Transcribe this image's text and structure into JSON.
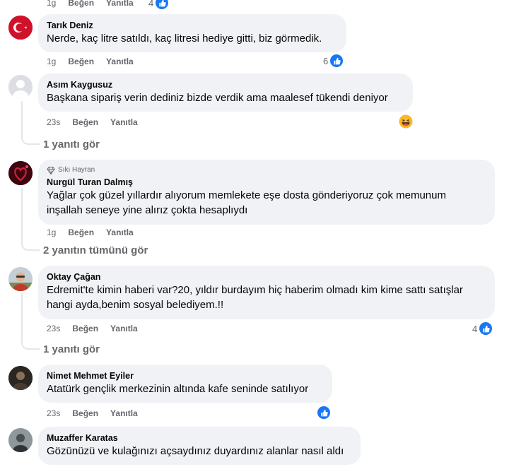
{
  "top": {
    "time": "1g",
    "like": "Beğen",
    "reply": "Yanıtla",
    "count": "4"
  },
  "comments": [
    {
      "name": "Tarık Deniz",
      "text": "Nerde, kaç litre satıldı, kaç litresi hediye gitti, biz görmedik.",
      "time": "1g",
      "like": "Beğen",
      "reply": "Yanıtla",
      "count": "6"
    },
    {
      "name": "Asım Kaygusuz",
      "text": "Başkana sipariş verin dediniz bizde verdik ama maalesef tükendi deniyor",
      "time": "23s",
      "like": "Beğen",
      "reply": "Yanıtla",
      "reaction": "haha-emoji",
      "replies": "1 yanıtı gör"
    },
    {
      "badge": "Sıkı Hayran",
      "name": "Nurgül Turan Dalmış",
      "text1": "Yağlar çok güzel yıllardır alıyorum memlekete eşe dosta gönderiyoruz çok memunum",
      "text2": "inşallah seneye yine alırız çokta hesaplıydı",
      "time": "1g",
      "like": "Beğen",
      "reply": "Yanıtla",
      "replies": "2 yanıtın tümünü gör"
    },
    {
      "name": "Oktay Çağan",
      "text1": "Edremit'te kimin haberi var?20, yıldır burdayım hiç haberim olmadı kim kime sattı satışlar",
      "text2": "hangi ayda,benim sosyal belediyem.!!",
      "time": "23s",
      "like": "Beğen",
      "reply": "Yanıtla",
      "count": "4",
      "replies": "1 yanıtı gör"
    },
    {
      "name": "Nimet Mehmet Eyiler",
      "text": "Atatürk gençlik merkezinin altında kafe seninde satılıyor",
      "time": "23s",
      "like": "Beğen",
      "reply": "Yanıtla"
    },
    {
      "name": "Muzaffer Karatas",
      "text": "Gözünüzü ve kulağınızı açsaydınız duyardınız alanlar nasıl aldı"
    }
  ],
  "colors": {
    "bubble": "#f0f2f5",
    "meta": "#65676b",
    "like_blue": "#1877f2"
  },
  "icons": {
    "like": "thumbs-up-icon",
    "haha": "laughing-emoji-icon",
    "badge": "diamond-icon"
  }
}
